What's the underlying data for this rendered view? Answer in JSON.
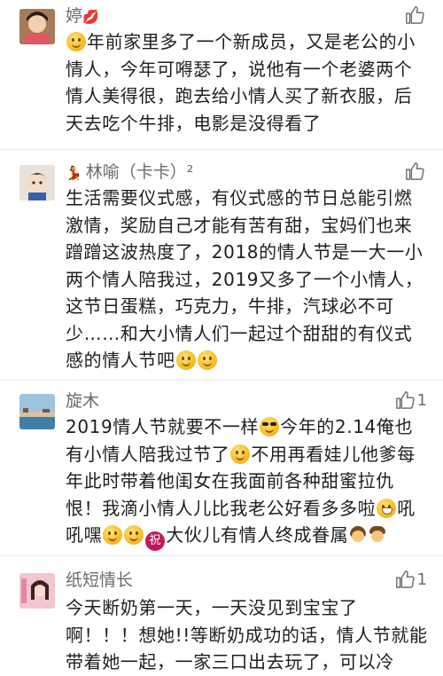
{
  "comments": [
    {
      "name": "婷",
      "name_suffix": "💋",
      "likes": "",
      "text": "年前家里多了一个新成员，又是老公的小情人，今年可嘚瑟了，说他有一个老婆两个情人美得很，跑去给小情人买了新衣服，后天去吃个牛排，电影是没得看了"
    },
    {
      "name": "林喻（卡卡）²",
      "name_prefix": "💃",
      "likes": "",
      "text": "生活需要仪式感，有仪式感的节日总能引燃激情，奖励自己才能有苦有甜，宝妈们也来蹭蹭这波热度了，2018的情人节是一大一小两个情人陪我过，2019又多了一个小情人，这节日蛋糕，巧克力，牛排，汽球必不可少……和大小情人们一起过个甜甜的有仪式感的情人节吧"
    },
    {
      "name": "旋木",
      "likes": "1",
      "text_parts": [
        "2019情人节就要不一样",
        "今年的2.14俺也有小情人陪我过节了",
        "不用再看娃儿他爹每年此时带着他闺女在我面前各种甜蜜拉仇恨！我滴小情人儿比我老公好看多多啦",
        "吼吼嘿",
        "大伙儿有情人终成眷属"
      ],
      "blessing_char": "祝"
    },
    {
      "name": "纸短情长",
      "likes": "1",
      "text": "今天断奶第一天，一天没见到宝宝了啊！！！想她!!等断奶成功的话，情人节就能带着她一起，一家三口出去玩了，可以冷"
    }
  ],
  "icons": {
    "like": "thumbs-up-icon",
    "accent_color": "#6b6b6b"
  }
}
